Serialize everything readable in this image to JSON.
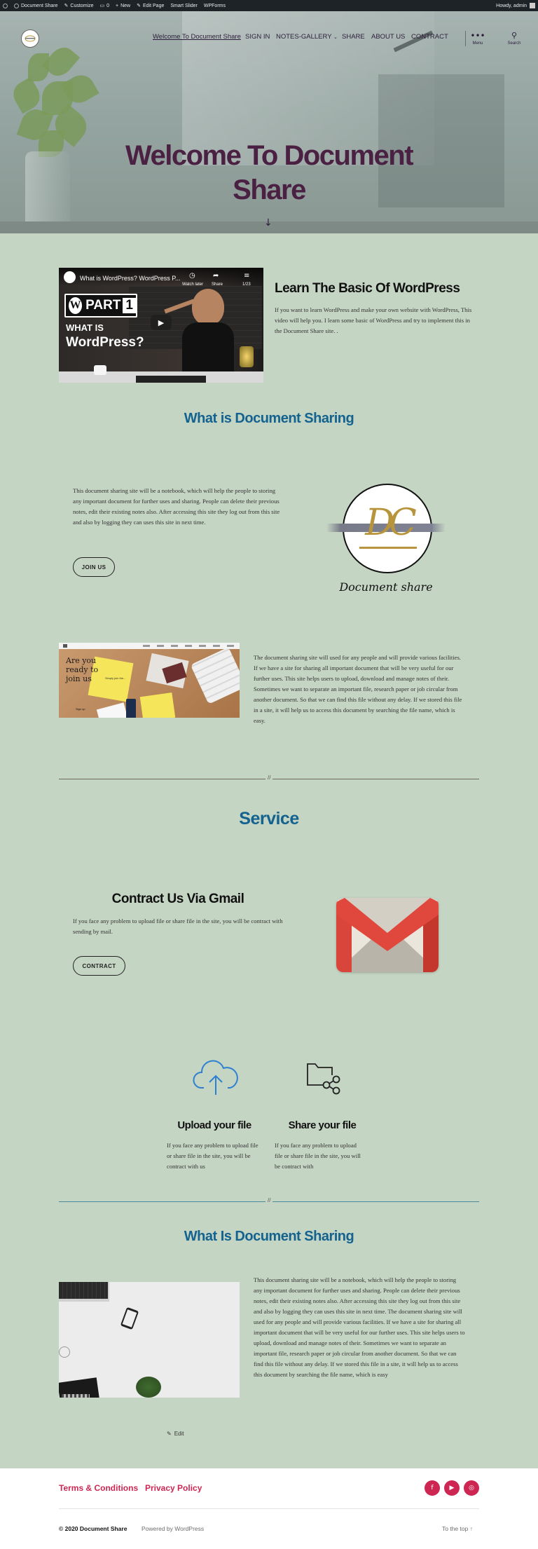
{
  "admin_bar": {
    "site_name": "Document Share",
    "customize": "Customize",
    "comments_count": "0",
    "new": "New",
    "edit_page": "Edit Page",
    "smart_slider": "Smart Slider",
    "wpforms": "WPForms",
    "howdy": "Howdy, admin"
  },
  "nav": {
    "items": [
      "Welcome To Document Share",
      "SIGN IN",
      "NOTES-GALLERY",
      "SHARE",
      "ABOUT US",
      "CONTRACT"
    ],
    "menu_label": "Menu",
    "search_label": "Search"
  },
  "hero": {
    "title_line1": "Welcome To Document",
    "title_line2": "Share"
  },
  "video": {
    "title": "What is WordPress? WordPress P...",
    "watch_later": "Watch later",
    "share": "Share",
    "counter": "1/23",
    "part_label": "PART",
    "part_number": "1",
    "what_is": "WHAT IS",
    "wordpress": "WordPress?"
  },
  "learn": {
    "heading": "Learn The Basic Of WordPress",
    "text": "If you want to learn WordPress and make your own website with WordPress, This video will help you. I learn some basic of WordPress and try to implement this in the Document Share site. ."
  },
  "section1": {
    "heading": "What is Document Sharing",
    "text": "This document sharing site will be a notebook, which will help the people to storing any important document for further uses and sharing. People can delete their previous notes, edit their existing notes also. After accessing this site they log out from this site and also by logging they can uses this site in next time.",
    "button": "JOIN US",
    "logo_caption": "Document share",
    "logo_letters": "DC"
  },
  "section2": {
    "mockup_title": "Are you ready to join us",
    "mockup_signup": "Sign up",
    "mockup_note": "Simply join the...",
    "text": "The document sharing site will used for any people and will provide various facilities. If we have a site for sharing all important document that will be very useful for our further uses. This site helps users to upload, download and manage notes of their. Sometimes we want to separate an important file, research paper or job circular from another document. So that we can find this file without any delay. If we stored this file in a site, it will help us to access this document by searching the file name, which is easy."
  },
  "separator": "//",
  "service": {
    "heading": "Service",
    "gmail_heading": "Contract Us Via Gmail",
    "gmail_text": "If you face any problem to upload file or share file in the site, you will be contract with sending by mail.",
    "button": "CONTRACT"
  },
  "features": [
    {
      "title": "Upload your file",
      "text": "If you face any problem to upload file or share file in the site, you will be contract with us",
      "icon": "cloud-upload-icon"
    },
    {
      "title": "Share your file",
      "text": "If you face any problem to upload file or share file in the site, you will be contract with",
      "icon": "folder-share-icon"
    }
  ],
  "section3": {
    "heading": "What Is Document Sharing",
    "text": "This document sharing site will be a notebook, which will help the people to storing any important document for further uses and sharing. People can delete their previous notes, edit their existing notes also. After accessing this site they log out from this site and also by logging they can uses this site in next time. The document sharing site will used for any people and will provide various facilities. If we have a site for sharing all important document that will be very useful for our further uses. This site helps users to upload, download and manage notes of their. Sometimes we want to separate an important file, research paper or job circular from another document. So that we can find this file without any delay. If we stored this file in a site, it will help us to access this document by searching the file name, which is easy"
  },
  "edit_link": "Edit",
  "footer": {
    "links": [
      "Terms & Conditions",
      "Privacy Policy"
    ],
    "copyright": "© 2020 Document Share",
    "powered": "Powered by WordPress",
    "to_top": "To the top ↑",
    "social": [
      "facebook-icon",
      "youtube-icon",
      "instagram-icon"
    ]
  },
  "colors": {
    "background": "#c5d5c3",
    "hero_title": "#4b2143",
    "heading_blue": "#14628f",
    "accent": "#cd2653"
  }
}
